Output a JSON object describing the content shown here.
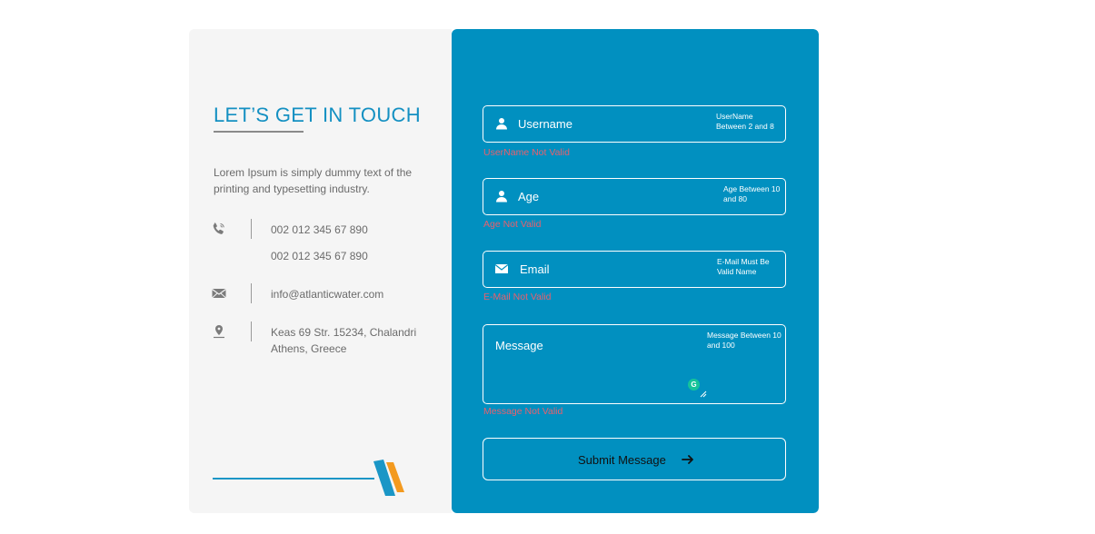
{
  "contact": {
    "title": "LET’S GET IN TOUCH",
    "description": "Lorem Ipsum is simply dummy text of the printing and typesetting industry.",
    "phones": [
      "002 012 345 67 890",
      "002 012 345 67 890"
    ],
    "email": "info@atlanticwater.com",
    "address_line1": "Keas 69 Str. 15234, Chalandri",
    "address_line2": "Athens, Greece",
    "icons": [
      "phone-icon",
      "envelope-icon",
      "map-pin-icon"
    ],
    "accent_color": "#1490c2",
    "logo_colors": [
      "#1a96c6",
      "#f39a1f"
    ]
  },
  "form": {
    "background_color": "#0190c0",
    "error_color": "#e8606e",
    "username": {
      "placeholder": "Username",
      "hint": "UserName Between 2 and 8",
      "error": "UserName Not Valid",
      "icon": "user-icon"
    },
    "age": {
      "placeholder": "Age",
      "hint": "Age Between 10 and 80",
      "error": "Age Not Valid",
      "icon": "user-icon"
    },
    "email": {
      "placeholder": "Email",
      "hint": "E-Mail Must Be Valid Name",
      "error": "E-Mail Not Valid",
      "icon": "envelope-icon"
    },
    "message": {
      "placeholder": "Message",
      "hint": "Message Between 10 and 100",
      "error": "Message Not Valid",
      "badge": "G"
    },
    "submit_label": "Submit Message",
    "submit_icon": "arrow-right-icon"
  }
}
